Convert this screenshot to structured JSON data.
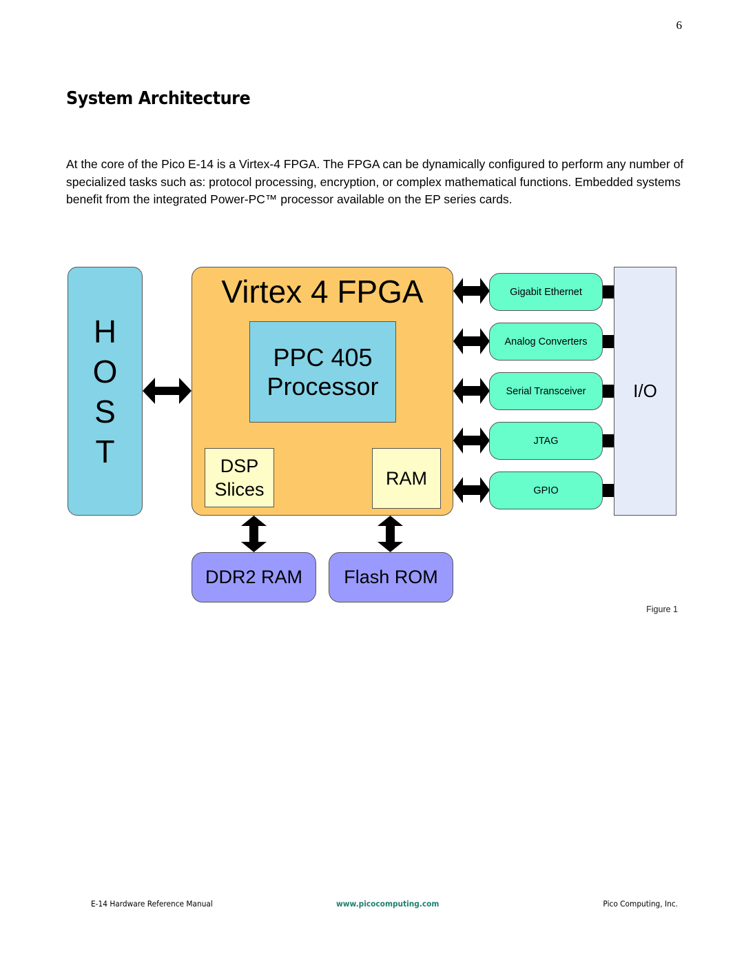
{
  "page": {
    "number": "6",
    "heading": "System Architecture",
    "paragraph": "At the core of the Pico E-14 is a Virtex-4 FPGA. The FPGA can be dynamically configured to perform any number of specialized tasks such as: protocol processing, encryption, or complex mathematical functions. Embedded systems benefit from the integrated Power-PC™ processor available on the EP series cards."
  },
  "diagram": {
    "host": {
      "letters": [
        "H",
        "O",
        "S",
        "T"
      ]
    },
    "fpga": {
      "title": "Virtex 4 FPGA",
      "processor": {
        "line1": "PPC 405",
        "line2": "Processor"
      },
      "dsp": {
        "line1": "DSP",
        "line2": "Slices"
      },
      "ram": "RAM"
    },
    "io_interfaces": [
      {
        "label": "Gigabit Ethernet"
      },
      {
        "label": "Analog Converters"
      },
      {
        "label": "Serial Transceiver"
      },
      {
        "label": "JTAG"
      },
      {
        "label": "GPIO"
      }
    ],
    "io_panel": "I/O",
    "memory": [
      {
        "label": "DDR2 RAM"
      },
      {
        "label": "Flash ROM"
      }
    ],
    "colors": {
      "host": "#85d3e7",
      "fpga": "#fdc968",
      "processor": "#85d3e7",
      "dsp_ram": "#fefdc8",
      "io_interface": "#67fecc",
      "io_panel": "#e6ebf9",
      "memory": "#9a9afe"
    },
    "caption": "Figure 1"
  },
  "footer": {
    "left": "E-14 Hardware Reference Manual",
    "center": "www.picocomputing.com",
    "right": "Pico Computing, Inc."
  }
}
